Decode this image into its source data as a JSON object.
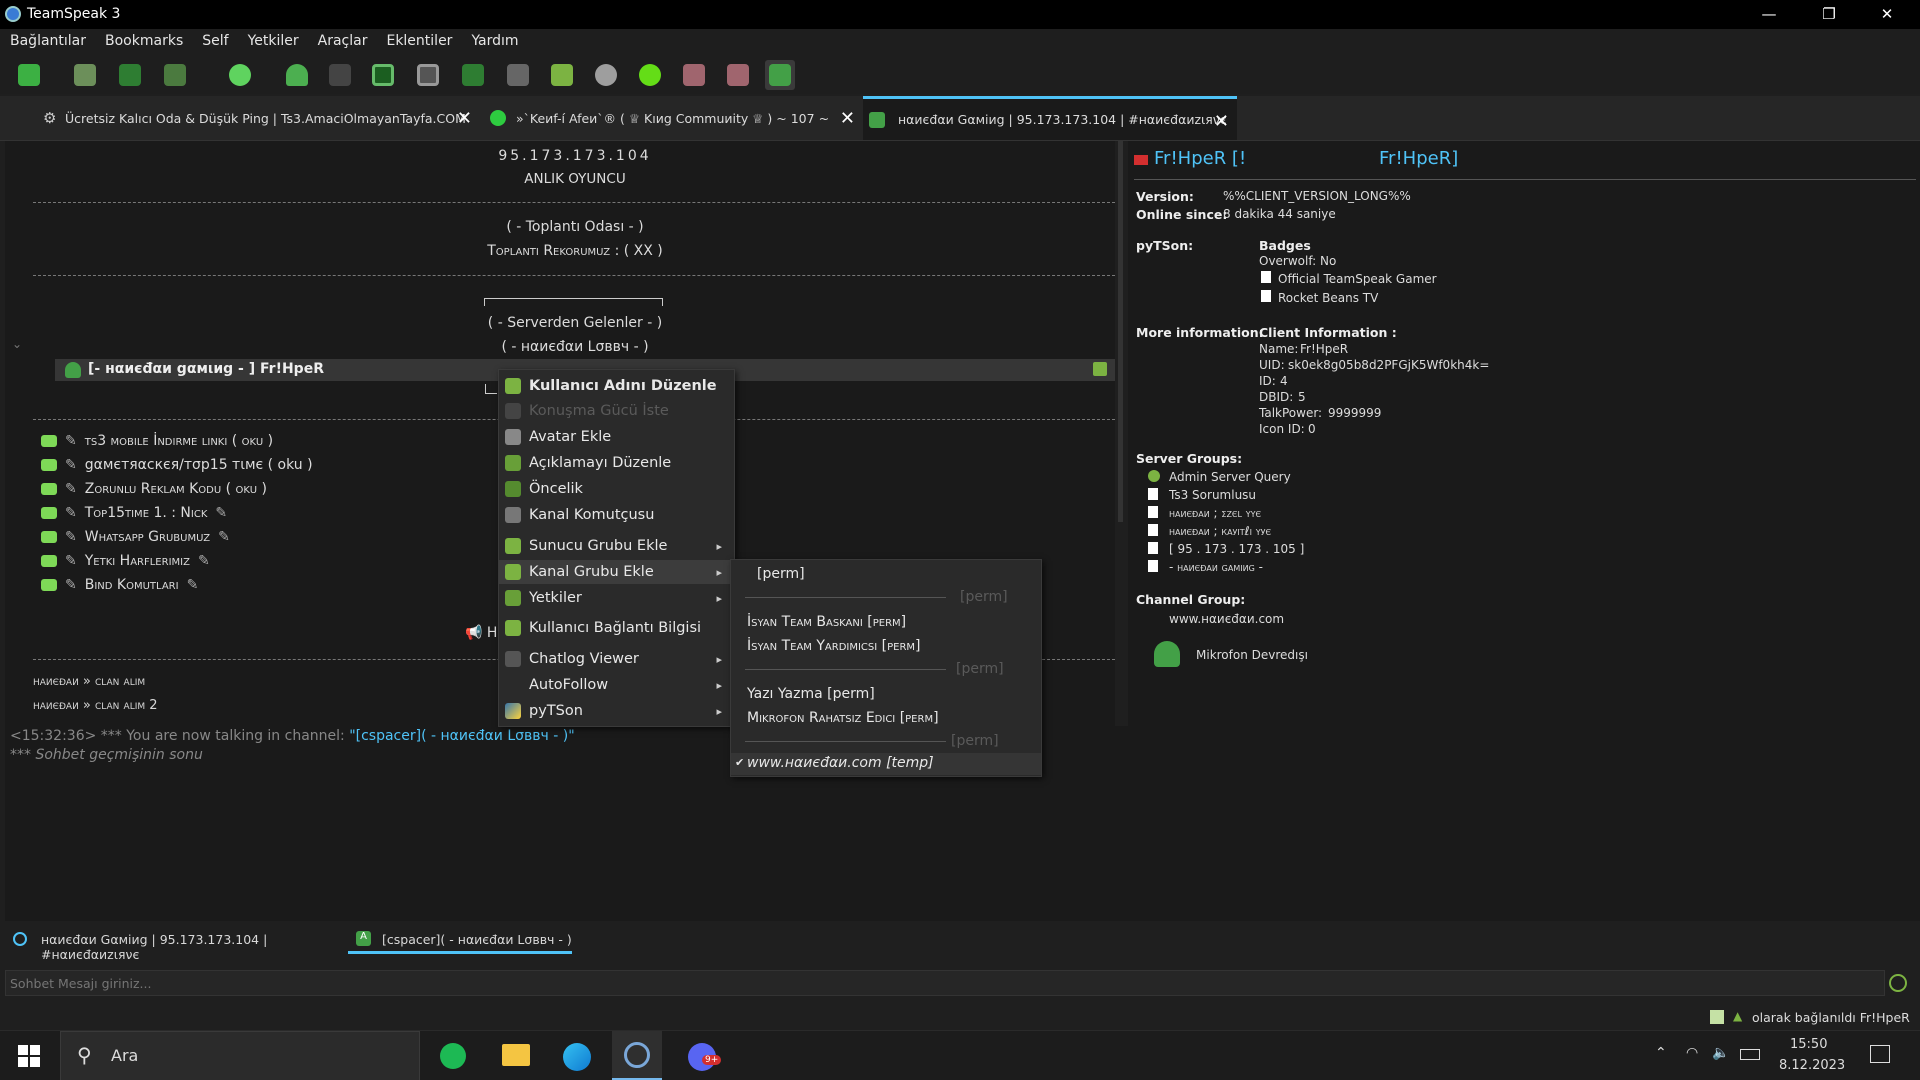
{
  "window": {
    "title": "TeamSpeak 3",
    "min": "—",
    "max": "❐",
    "close": "✕"
  },
  "menu": [
    "Bağlantılar",
    "Bookmarks",
    "Self",
    "Yetkiler",
    "Araçlar",
    "Eklentiler",
    "Yardım"
  ],
  "tabs": [
    {
      "label": "Ücretsiz Kalıcı Oda & Düşük Ping | Ts3.AmaciOlmayanTayfa.COM",
      "close": "✕"
    },
    {
      "label": "»`Keиf-í Afeи`® ( ♕ Kıиg Commuиity ♕ ) ~ 107 ~",
      "close": "✕"
    },
    {
      "label": "нαиєđαи Gαмiиg | 95.173.173.104 | #нαиєđαиzιяνє",
      "close": "✕"
    }
  ],
  "tree": {
    "server_ip": "95.173.173.104",
    "anlik": "ANLIK OYUNCU",
    "toplanti_odasi": "( - Toplantı Odası - )",
    "toplanti_rekor": "Toplantı Rekorumuz : ( XX )",
    "serverden": "( - Serverden Gelenler - )",
    "lobby": "( - нαиєđαи Lσввч - )",
    "user_row": "[- нαиєđαи gαмιиg - ] Fr!HpeR",
    "channels": [
      "ts3 mobile İndirme linki ( oku )",
      "gαмєтяαcкєя/тσp15 тιмє ( oku )",
      "Zorunlu Reklam Kodu ( oku )",
      "Top15time 1. : Nick",
      "Whatsapp Grubumuz",
      "Yetki Harflerimiz",
      "Bind Komutları"
    ],
    "clan1": "нαиєđαи » clan alım",
    "clan2": "нαиєđαи » clan alım 2",
    "hidden_h": "H"
  },
  "context_menu": [
    {
      "label": "Kullanıcı Adını Düzenle",
      "bold": true
    },
    {
      "label": "Konuşma Gücü İste",
      "disabled": true
    },
    {
      "label": "Avatar Ekle"
    },
    {
      "label": "Açıklamayı Düzenle"
    },
    {
      "label": "Öncelik"
    },
    {
      "label": "Kanal Komutçusu"
    },
    {
      "label": "Sunucu Grubu Ekle",
      "sub": true
    },
    {
      "label": "Kanal Grubu Ekle",
      "sub": true
    },
    {
      "label": "Yetkiler",
      "sub": true
    },
    {
      "label": "Kullanıcı Bağlantı Bilgisi"
    },
    {
      "label": "Chatlog Viewer",
      "sub": true
    },
    {
      "label": "AutoFollow",
      "sub": true
    },
    {
      "label": "pyTSon",
      "sub": true
    }
  ],
  "submenu": {
    "perm_top": "[perm]",
    "perm_dis1": "[perm]",
    "isyan_baskan": "İsyan Team Baskanı [perm]",
    "isyan_yard": "İsyan Team Yardımıcsı [perm]",
    "perm_dis2": "[perm]",
    "yazi": "Yazı Yazma [perm]",
    "mikrofon": "Mikrofon Rahatsız Edici [perm]",
    "perm_dis3": "[perm]",
    "www": "www.нαиєđαи.com [temp]",
    "check": "✔"
  },
  "info": {
    "name_left": "Fr!HpeR [!",
    "name_right": "Fr!HpeR]",
    "version_label": "Version:",
    "version": "%%CLIENT_VERSION_LONG%%",
    "online_label": "Online since:",
    "online": "8 dakika 44 saniye",
    "pytson_label": "pyTSon:",
    "badges_label": "Badges",
    "overwolf_label": "Overwolf:",
    "overwolf": "No",
    "badge1": "Official TeamSpeak Gamer",
    "badge2": "Rocket Beans TV",
    "more_label": "More information:",
    "client_info_label": "Client Information :",
    "name_label": "Name:",
    "name_val": "Fr!HpeR",
    "uid_label": "UID:",
    "uid_val": "sk0ek8g05b8d2PFGjK5Wf0kh4k=",
    "id_label": "ID:",
    "id_val": "4",
    "dbid_label": "DBID:",
    "dbid_val": "5",
    "talk_label": "TalkPower:",
    "talk_val": "9999999",
    "iconid_label": "Icon ID:",
    "iconid_val": "0",
    "sg_label": "Server Groups:",
    "groups": [
      "Admin Server Query",
      "Ts3 Sorumlusu",
      "нαиєđαи ; σzєl υyє",
      "нαиєđαи ; кαуιтℓι υує",
      "[ 95 . 173 . 173 . 105 ]",
      "- нαиєđαи gαмιиg -"
    ],
    "cg_label": "Channel Group:",
    "cg_val": "www.нαиєđαи.com",
    "mic": "Mikrofon Devredışı"
  },
  "chat": {
    "time": "<15:32:36>",
    "line1": " *** You are now talking in channel: ",
    "channel_link": "\"[cspacer]( - нαиєđαи Lσввч - )\"",
    "line2": "*** Sohbet geçmişinin sonu"
  },
  "bottom_tabs": [
    "нαиєđαи Gαмiиg | 95.173.173.104 | #нαиєđαиzιяνє",
    "[cspacer]( - нαиєđαи Lσввч - )"
  ],
  "message_placeholder": "Sohbet Mesajı giriniz...",
  "status": "olarak bağlanıldı Fr!HpeR",
  "taskbar": {
    "search": "Ara",
    "time": "15:50",
    "date": "8.12.2023",
    "badge": "9+"
  },
  "colors": {
    "accent": "#4fc3f7",
    "green": "#7ed957",
    "red": "#e02020",
    "bg": "#1a1a1a"
  }
}
